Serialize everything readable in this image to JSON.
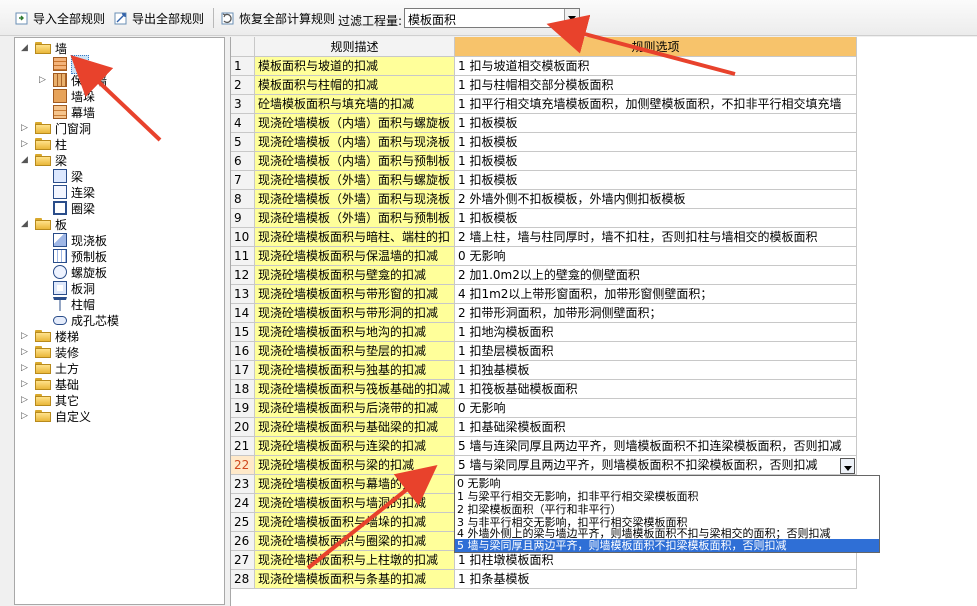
{
  "toolbar": {
    "import_label": "导入全部规则",
    "export_label": "导出全部规则",
    "restore_label": "恢复全部计算规则",
    "filter_label": "过滤工程量:",
    "filter_value": "模板面积"
  },
  "tree": {
    "wall": "墙",
    "wall_child_wall": "墙",
    "wall_child_insulation": "保温墙",
    "wall_child_pier": "墙垛",
    "wall_child_curtain": "幕墙",
    "door_window": "门窗洞",
    "column": "柱",
    "beam": "梁",
    "beam_child_beam": "梁",
    "beam_child_link": "连梁",
    "beam_child_ring": "圈梁",
    "slab": "板",
    "slab_child_cast": "现浇板",
    "slab_child_precast": "预制板",
    "slab_child_spiral": "螺旋板",
    "slab_child_hole": "板洞",
    "slab_child_cap": "柱帽",
    "slab_child_core": "成孔芯模",
    "stairs": "楼梯",
    "decoration": "装修",
    "earthwork": "土方",
    "foundation": "基础",
    "other": "其它",
    "custom": "自定义"
  },
  "grid": {
    "header_desc": "规则描述",
    "header_opt": "规则选项",
    "rows": [
      {
        "n": "1",
        "desc": "模板面积与坡道的扣减",
        "opt": "1 扣与坡道相交模板面积"
      },
      {
        "n": "2",
        "desc": "模板面积与柱帽的扣减",
        "opt": "1 扣与柱帽相交部分模板面积"
      },
      {
        "n": "3",
        "desc": "砼墙模板面积与填充墙的扣减",
        "opt": "1 扣平行相交填充墙模板面积，加侧壁模板面积，不扣非平行相交填充墙"
      },
      {
        "n": "4",
        "desc": "现浇砼墙模板（内墙）面积与螺旋板",
        "opt": "1  扣板模板"
      },
      {
        "n": "5",
        "desc": "现浇砼墙模板（内墙）面积与现浇板",
        "opt": "1  扣板模板"
      },
      {
        "n": "6",
        "desc": "现浇砼墙模板（内墙）面积与预制板",
        "opt": "1  扣板模板"
      },
      {
        "n": "7",
        "desc": "现浇砼墙模板（外墙）面积与螺旋板",
        "opt": "1  扣板模板"
      },
      {
        "n": "8",
        "desc": "现浇砼墙模板（外墙）面积与现浇板",
        "opt": "2  外墙外侧不扣板模板，外墙内侧扣板模板"
      },
      {
        "n": "9",
        "desc": "现浇砼墙模板（外墙）面积与预制板",
        "opt": "1  扣板模板"
      },
      {
        "n": "10",
        "desc": "现浇砼墙模板面积与暗柱、端柱的扣",
        "opt": "2  墙上柱，墙与柱同厚时，墙不扣柱，否则扣柱与墙相交的模板面积"
      },
      {
        "n": "11",
        "desc": "现浇砼墙模板面积与保温墙的扣减",
        "opt": "0  无影响"
      },
      {
        "n": "12",
        "desc": "现浇砼墙模板面积与壁龛的扣减",
        "opt": "2  加1.0m2以上的壁龛的侧壁面积"
      },
      {
        "n": "13",
        "desc": "现浇砼墙模板面积与带形窗的扣减",
        "opt": "4  扣1m2以上带形窗面积，加带形窗侧壁面积；"
      },
      {
        "n": "14",
        "desc": "现浇砼墙模板面积与带形洞的扣减",
        "opt": "2  扣带形洞面积，加带形洞侧壁面积；"
      },
      {
        "n": "15",
        "desc": "现浇砼墙模板面积与地沟的扣减",
        "opt": "1  扣地沟模板面积"
      },
      {
        "n": "16",
        "desc": "现浇砼墙模板面积与垫层的扣减",
        "opt": "1  扣垫层模板面积"
      },
      {
        "n": "17",
        "desc": "现浇砼墙模板面积与独基的扣减",
        "opt": "1  扣独基模板"
      },
      {
        "n": "18",
        "desc": "现浇砼墙模板面积与筏板基础的扣减",
        "opt": "1  扣筏板基础模板面积"
      },
      {
        "n": "19",
        "desc": "现浇砼墙模板面积与后浇带的扣减",
        "opt": "0  无影响"
      },
      {
        "n": "20",
        "desc": "现浇砼墙模板面积与基础梁的扣减",
        "opt": "1  扣基础梁模板面积"
      },
      {
        "n": "21",
        "desc": "现浇砼墙模板面积与连梁的扣减",
        "opt": "5 墙与连梁同厚且两边平齐，则墙模板面积不扣连梁模板面积，否则扣减"
      },
      {
        "n": "22",
        "desc": "现浇砼墙模板面积与梁的扣减",
        "opt": "5  墙与梁同厚且两边平齐，则墙模板面积不扣梁模板面积，否则扣减"
      },
      {
        "n": "23",
        "desc": "现浇砼墙模板面积与幕墙的扣减",
        "opt": ""
      },
      {
        "n": "24",
        "desc": "现浇砼墙模板面积与墙洞的扣减",
        "opt": ""
      },
      {
        "n": "25",
        "desc": "现浇砼墙模板面积与墙垛的扣减",
        "opt": ""
      },
      {
        "n": "26",
        "desc": "现浇砼墙模板面积与圈梁的扣减",
        "opt": ""
      },
      {
        "n": "27",
        "desc": "现浇砼墙模板面积与上柱墩的扣减",
        "opt": "1  扣柱墩模板面积"
      },
      {
        "n": "28",
        "desc": "现浇砼墙模板面积与条基的扣减",
        "opt": "1  扣条基模板"
      }
    ]
  },
  "dropdown": {
    "items": [
      "0  无影响",
      "1  与梁平行相交无影响，扣非平行相交梁模板面积",
      "2  扣梁模板面积（平行和非平行）",
      "3  与非平行相交无影响，扣平行相交梁模板面积",
      "4  外墙外侧上的梁与墙边平齐，则墙模板面积不扣与梁相交的面积；否则扣减",
      "5  墙与梁同厚且两边平齐，则墙模板面积不扣梁模板面积，否则扣减"
    ]
  },
  "colors": {
    "desc_bg": "#ffff9a",
    "header_opt_bg": "#f7c36b",
    "selection": "#2f6fd6",
    "arrow": "#e8422c"
  }
}
